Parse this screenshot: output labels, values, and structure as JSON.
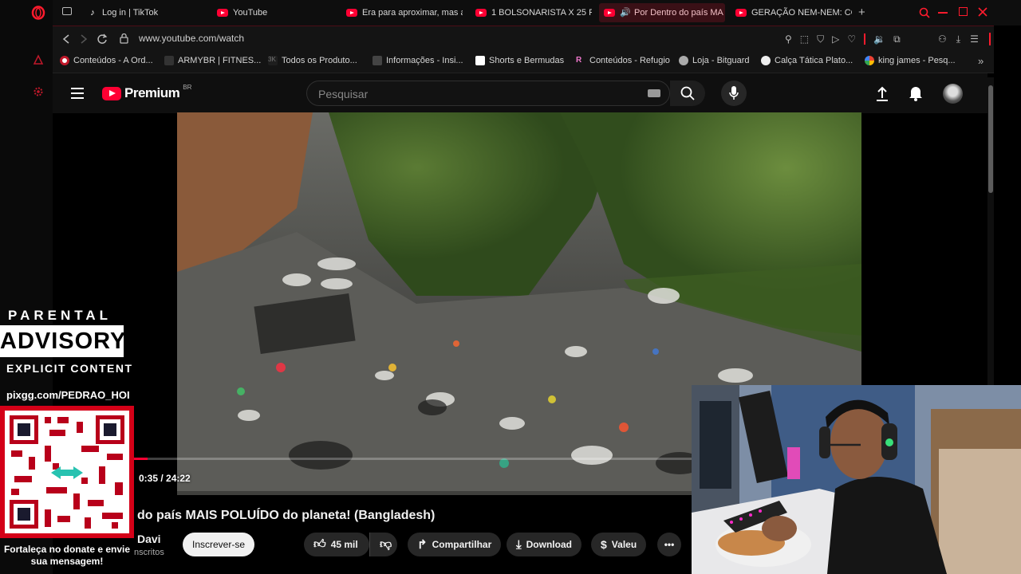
{
  "browser": {
    "tabs": [
      {
        "label": "Log in | TikTok",
        "icon": "tiktok-icon"
      },
      {
        "label": "YouTube",
        "icon": "youtube-icon"
      },
      {
        "label": "Era para aproximar, mas a",
        "icon": "youtube-icon"
      },
      {
        "label": "1 BOLSONARISTA X 25 PE",
        "icon": "youtube-icon"
      },
      {
        "label": "Por Dentro do país MA",
        "icon": "youtube-icon",
        "active": true
      },
      {
        "label": "GERAÇÃO NEM-NEM: CO",
        "icon": "youtube-icon"
      }
    ],
    "url": "www.youtube.com/watch",
    "bookmarks": [
      {
        "label": "Conteúdos - A Ord..."
      },
      {
        "label": "ARMYBR | FITNES..."
      },
      {
        "label": "Todos os Produto..."
      },
      {
        "label": "Informações - Insi..."
      },
      {
        "label": "Shorts e Bermudas"
      },
      {
        "label": "Conteúdos - Refugio"
      },
      {
        "label": "Loja - Bitguard"
      },
      {
        "label": "Calça Tática Plato..."
      },
      {
        "label": "king james - Pesq..."
      }
    ],
    "accent": "#ff1b2d"
  },
  "youtube": {
    "logo_text": "Premium",
    "logo_region": "BR",
    "search_placeholder": "Pesquisar",
    "video": {
      "time": "0:35 / 24:22",
      "progress": 0.024,
      "title": "do país MAIS POLUÍDO do planeta! (Bangladesh)",
      "channel": "Davi",
      "subs": "nscritos",
      "subscribe_label": "Inscrever-se",
      "likes": "45 mil",
      "share_label": "Compartilhar",
      "download_label": "Download",
      "valeu_label": "Valeu"
    }
  },
  "overlay": {
    "parental_top": "PARENTAL",
    "parental_mid": "ADVISORY",
    "parental_bottom": "EXPLICIT CONTENT",
    "pix_url": "pixgg.com/PEDRAO_HOI",
    "donate_text": "Fortaleça no donate e envie sua mensagem!"
  }
}
